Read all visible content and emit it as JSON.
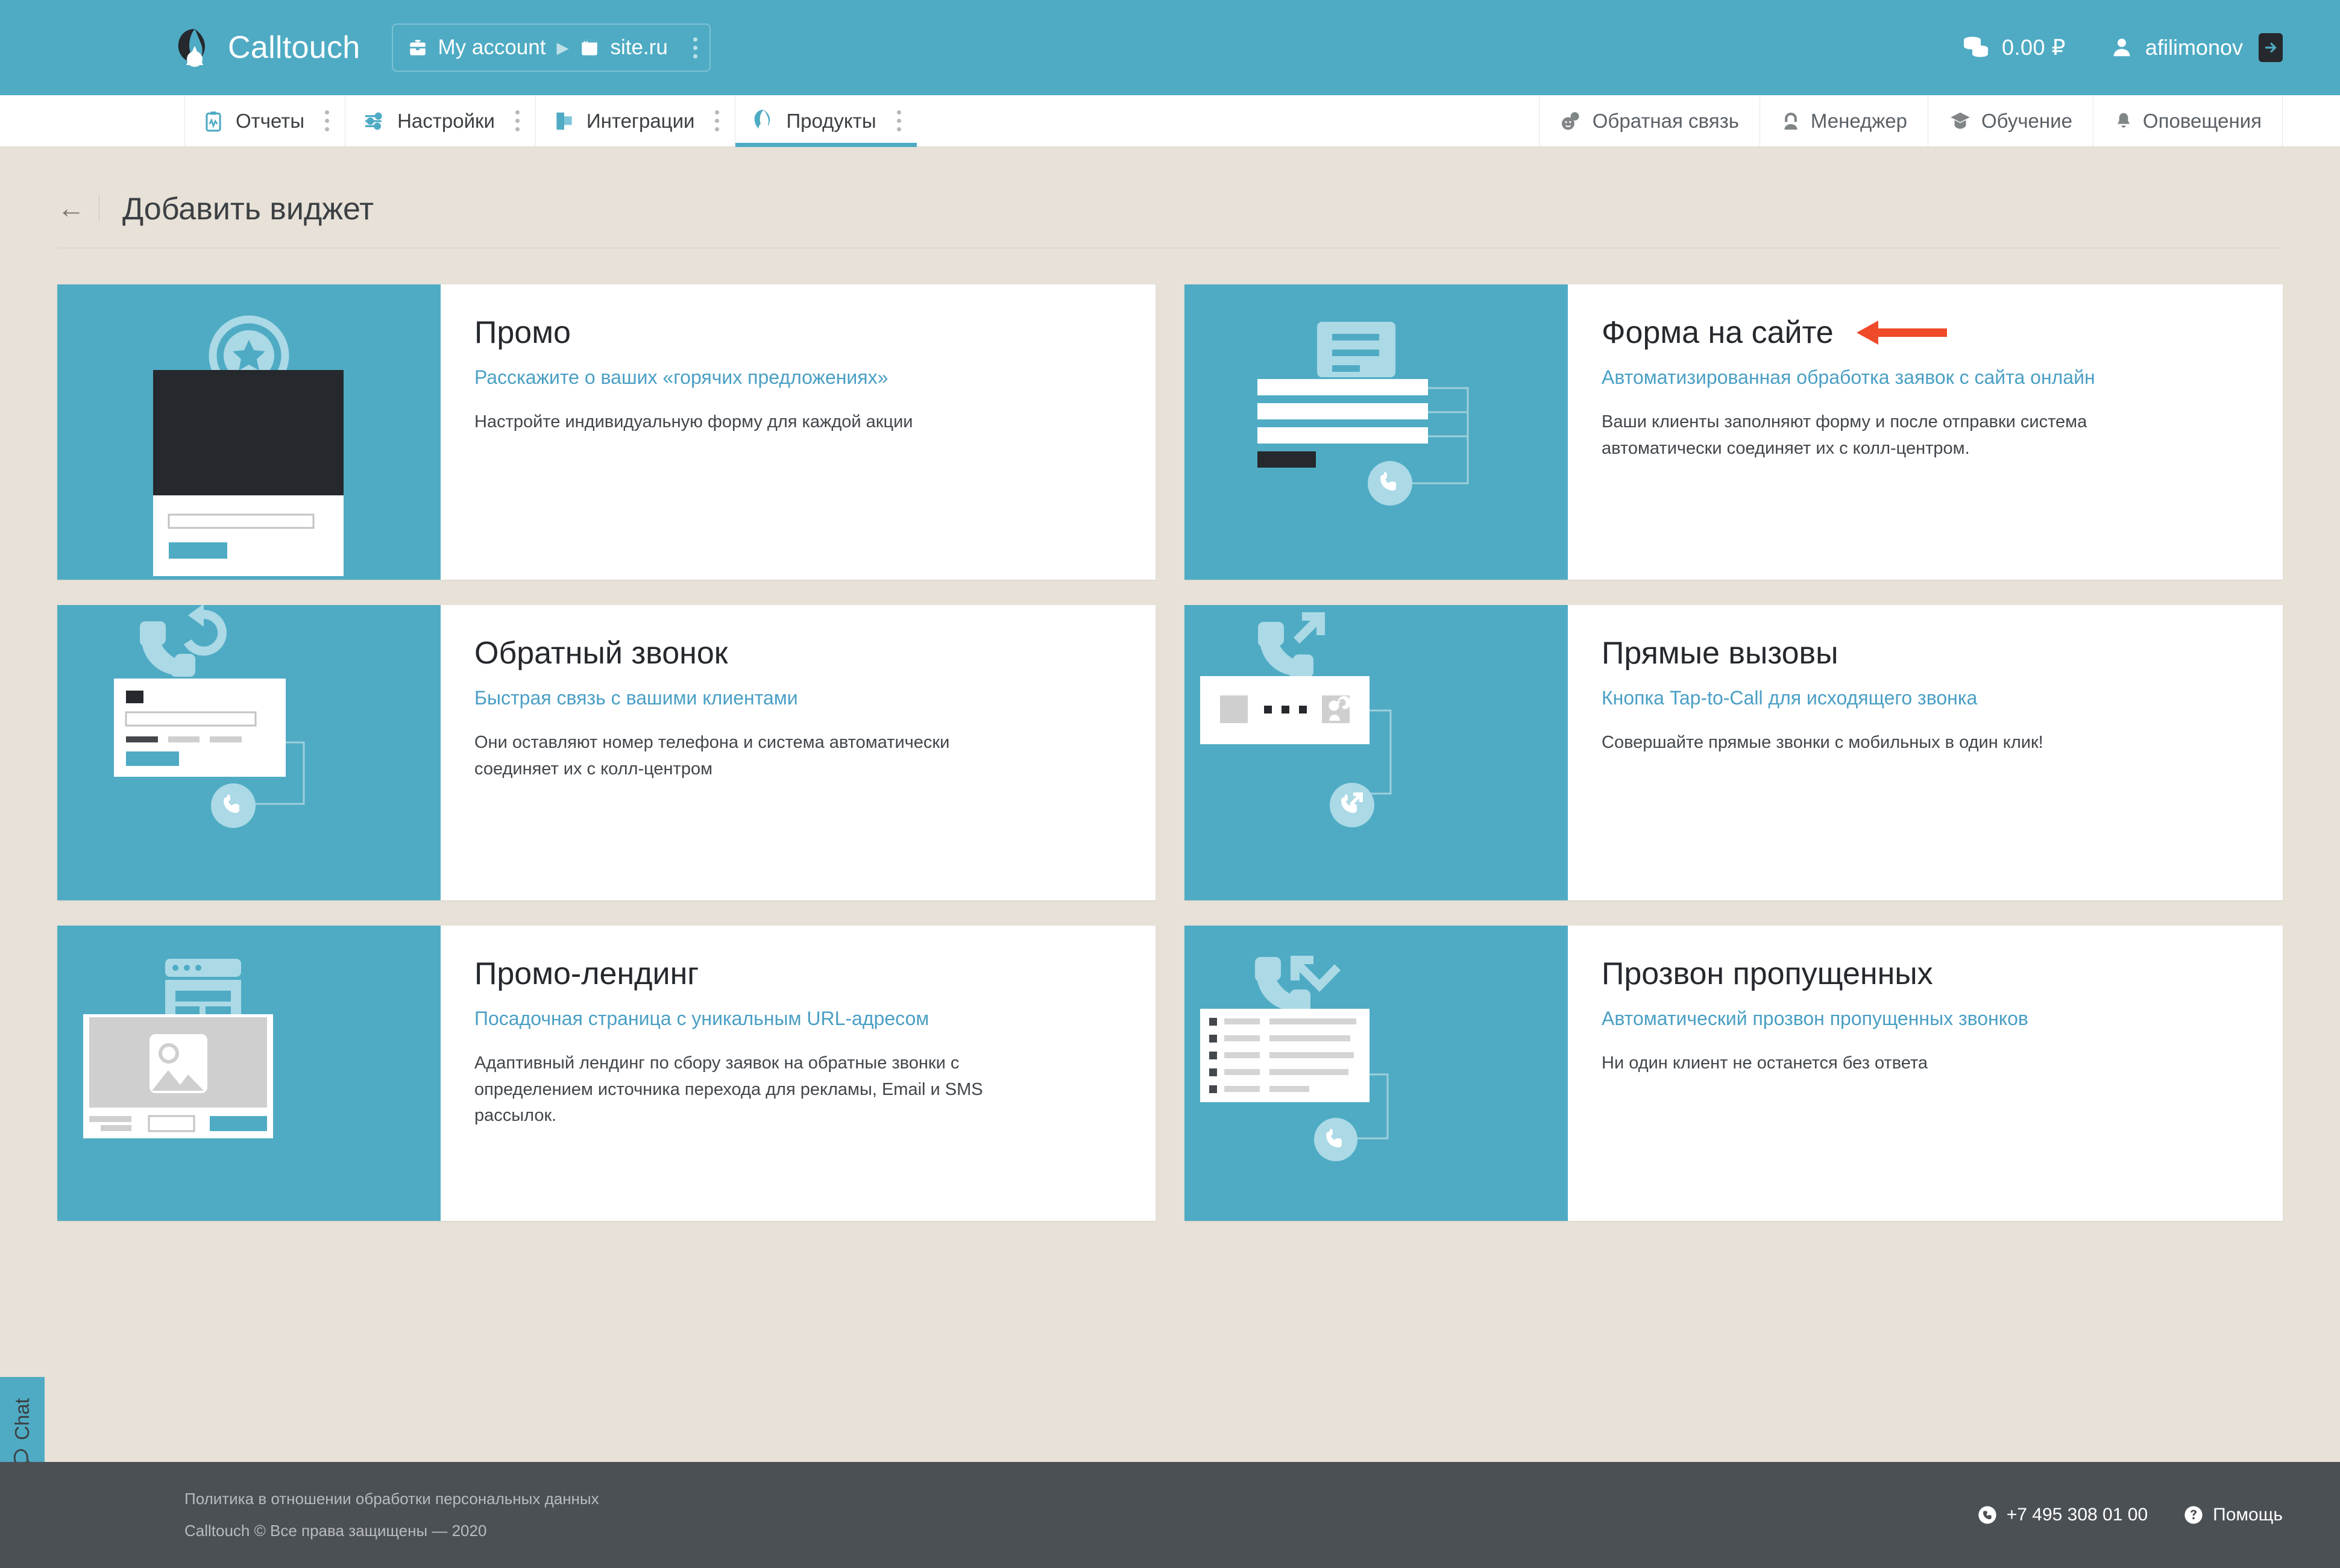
{
  "brand": {
    "name": "Calltouch",
    "logo_icon": "calltouch-logo-icon"
  },
  "account_switcher": {
    "account_label": "My account",
    "account_icon": "briefcase-icon",
    "separator": "▶",
    "site_label": "site.ru",
    "site_icon": "browser-window-icon",
    "menu_icon": "kebab-menu-icon"
  },
  "topbar_right": {
    "balance_icon": "coins-icon",
    "balance": "0.00 ₽",
    "user_icon": "user-avatar-icon",
    "username": "afilimonov",
    "logout_icon": "logout-arrow-icon"
  },
  "nav": {
    "left": [
      {
        "label": "Отчеты",
        "icon": "clipboard-chart-icon",
        "active": false
      },
      {
        "label": "Настройки",
        "icon": "sliders-icon",
        "active": false
      },
      {
        "label": "Интеграции",
        "icon": "puzzle-blocks-icon",
        "active": false
      },
      {
        "label": "Продукты",
        "icon": "calltouch-mark-icon",
        "active": true
      }
    ],
    "right": [
      {
        "label": "Обратная связь",
        "icon": "feedback-smiley-icon"
      },
      {
        "label": "Менеджер",
        "icon": "manager-person-icon"
      },
      {
        "label": "Обучение",
        "icon": "graduation-cap-icon"
      },
      {
        "label": "Оповещения",
        "icon": "bell-icon"
      }
    ]
  },
  "page": {
    "back_icon": "back-arrow-icon",
    "title": "Добавить виджет"
  },
  "cards": [
    {
      "id": "promo",
      "title": "Промо",
      "subtitle": "Расскажите о ваших «горячих предложениях»",
      "description": "Настройте индивидуальную форму для каждой акции",
      "illustration": "promo-star-popup-illustration",
      "highlighted": false
    },
    {
      "id": "site-form",
      "title": "Форма на сайте",
      "subtitle": "Автоматизированная обработка заявок с сайта онлайн",
      "description": "Ваши клиенты заполняют форму и после отправки система автоматически соединяет их с колл-центром.",
      "illustration": "site-form-illustration",
      "highlighted": true
    },
    {
      "id": "callback",
      "title": "Обратный звонок",
      "subtitle": "Быстрая связь с вашими клиентами",
      "description": "Они оставляют номер телефона и система автоматически соединяет их с колл-центром",
      "illustration": "callback-illustration",
      "highlighted": false
    },
    {
      "id": "direct-calls",
      "title": "Прямые вызовы",
      "subtitle": "Кнопка Tap-to-Call для исходящего звонка",
      "description": "Совершайте прямые звонки с мобильных в один клик!",
      "illustration": "direct-calls-illustration",
      "highlighted": false
    },
    {
      "id": "promo-landing",
      "title": "Промо-лендинг",
      "subtitle": "Посадочная страница с уникальным URL-адресом",
      "description": "Адаптивный лендинг по сбору заявок на обратные звонки с определением источника перехода для рекламы, Email и SMS рассылок.",
      "illustration": "promo-landing-illustration",
      "highlighted": false
    },
    {
      "id": "missed-calls",
      "title": "Прозвон пропущенных",
      "subtitle": "Автоматический прозвон пропущенных звонков",
      "description": "Ни один клиент не останется без ответа",
      "illustration": "missed-calls-illustration",
      "highlighted": false
    }
  ],
  "chat": {
    "label": "Chat",
    "icon": "chat-bubble-icon"
  },
  "footer": {
    "policy_link": "Политика в отношении обработки персональных данных",
    "copyright": "Calltouch © Все права защищены — 2020",
    "phone": "+7 495 308 01 00",
    "phone_icon": "phone-circle-icon",
    "help": "Помощь",
    "help_icon": "question-circle-icon"
  },
  "colors": {
    "brand_blue": "#4fabc4",
    "page_bg": "#e7e1d8",
    "accent_link": "#4a9fc4",
    "arrow_red": "#ef4a2a",
    "footer_bg": "#4b5055",
    "dark": "#25282c"
  }
}
